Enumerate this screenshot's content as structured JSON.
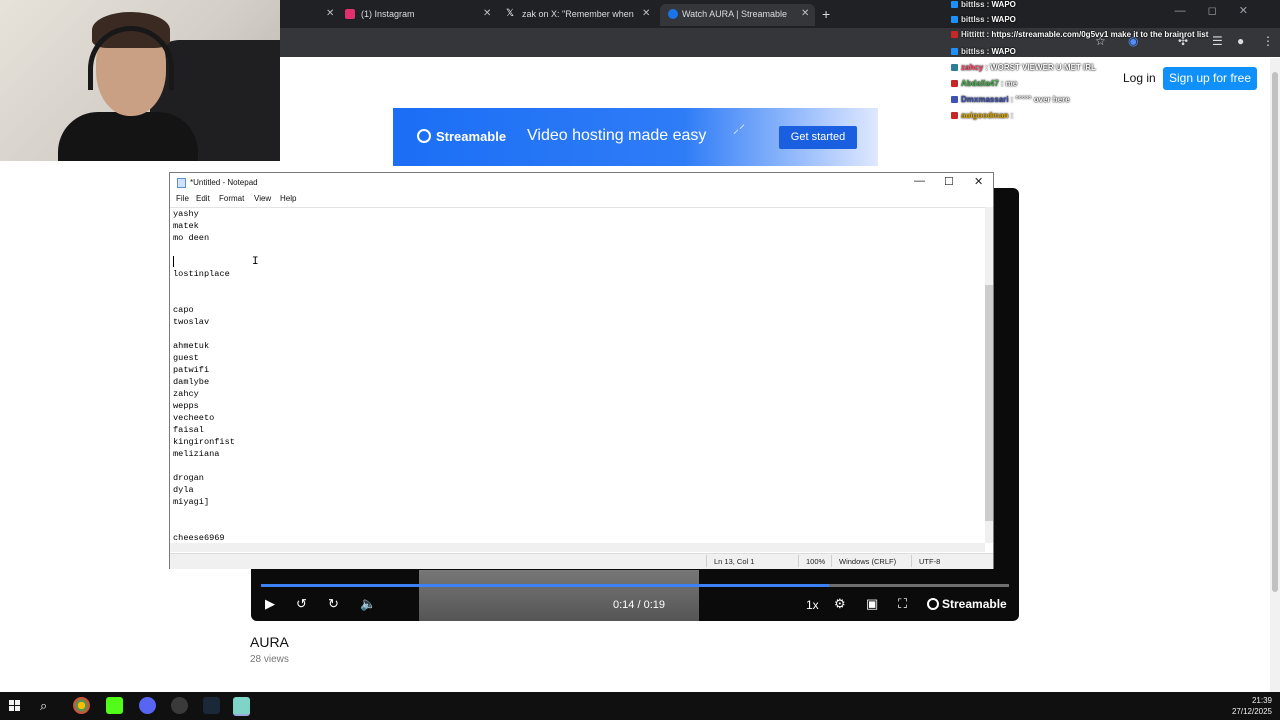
{
  "browser": {
    "tabs": [
      {
        "label": "",
        "favicon_color": "#5f6368"
      },
      {
        "label": "(1) Instagram",
        "favicon_color": "#e1306c"
      },
      {
        "label": "zak on X: \"Remember when xQ",
        "favicon_color": "#ffffff"
      },
      {
        "label": "Watch AURA | Streamable",
        "favicon_color": "#1a73e8"
      }
    ],
    "new_tab": "+"
  },
  "site": {
    "login": "Log in",
    "signup": "Sign up for free",
    "banner": {
      "logo": "Streamable",
      "tagline": "Video hosting made easy",
      "cta": "Get started"
    },
    "player": {
      "time": "0:14 / 0:19",
      "speed": "1x",
      "brand": "Streamable",
      "progress": 0.76
    },
    "video_title": "AURA",
    "views": "28 views"
  },
  "notepad": {
    "title": "*Untitled - Notepad",
    "menu": [
      "File",
      "Edit",
      "Format",
      "View",
      "Help"
    ],
    "text": "yashy\nmatek\nmo deen\n\n\nlostinplace\n\n\ncapo\ntwoslav\n\nahmetuk\nguest\npatwifi\ndamlybe\nzahcy\nwepps\nvecheeto\nfaisal\nkingironfist\nmeliziana\n\ndrogan\ndyla\nmiyagi]\n\n\ncheese6969",
    "status": {
      "position": "Ln 13, Col 1",
      "zoom": "100%",
      "line_endings": "Windows (CRLF)",
      "encoding": "UTF-8"
    }
  },
  "chat": [
    {
      "user": "bittlss",
      "msg": ": WAPO",
      "color": "#e9e9e9",
      "badge": "#1e90ff"
    },
    {
      "user": "bittlss",
      "msg": ": WAPO",
      "color": "#e9e9e9",
      "badge": "#1e90ff"
    },
    {
      "user": "Hittittt",
      "msg": ": https://streamable.com/0g5vv1 make it to the brainrot list",
      "color": "#e9e9e9",
      "badge": "#c62828"
    },
    {
      "user": "bittlss",
      "msg": ": WAPO",
      "color": "#e9e9e9",
      "badge": "#1e90ff"
    },
    {
      "user": "zahcy",
      "msg": ": WORST VIEWER U MET IRL",
      "color": "#ff4d6d",
      "badge": "#2e7d9a"
    },
    {
      "user": "Abdalla47",
      "msg": ": me",
      "color": "#4caf50",
      "badge": "#c62828"
    },
    {
      "user": "Dmxmassari",
      "msg": ": °°°°° over here",
      "color": "#3f51b5",
      "badge": "#3f51b5"
    },
    {
      "user": "auigoodman",
      "msg": ": ",
      "color": "#e0a800",
      "badge": "#c62828"
    }
  ],
  "taskbar": {
    "time": "21:39",
    "date": "27/12/2025"
  }
}
